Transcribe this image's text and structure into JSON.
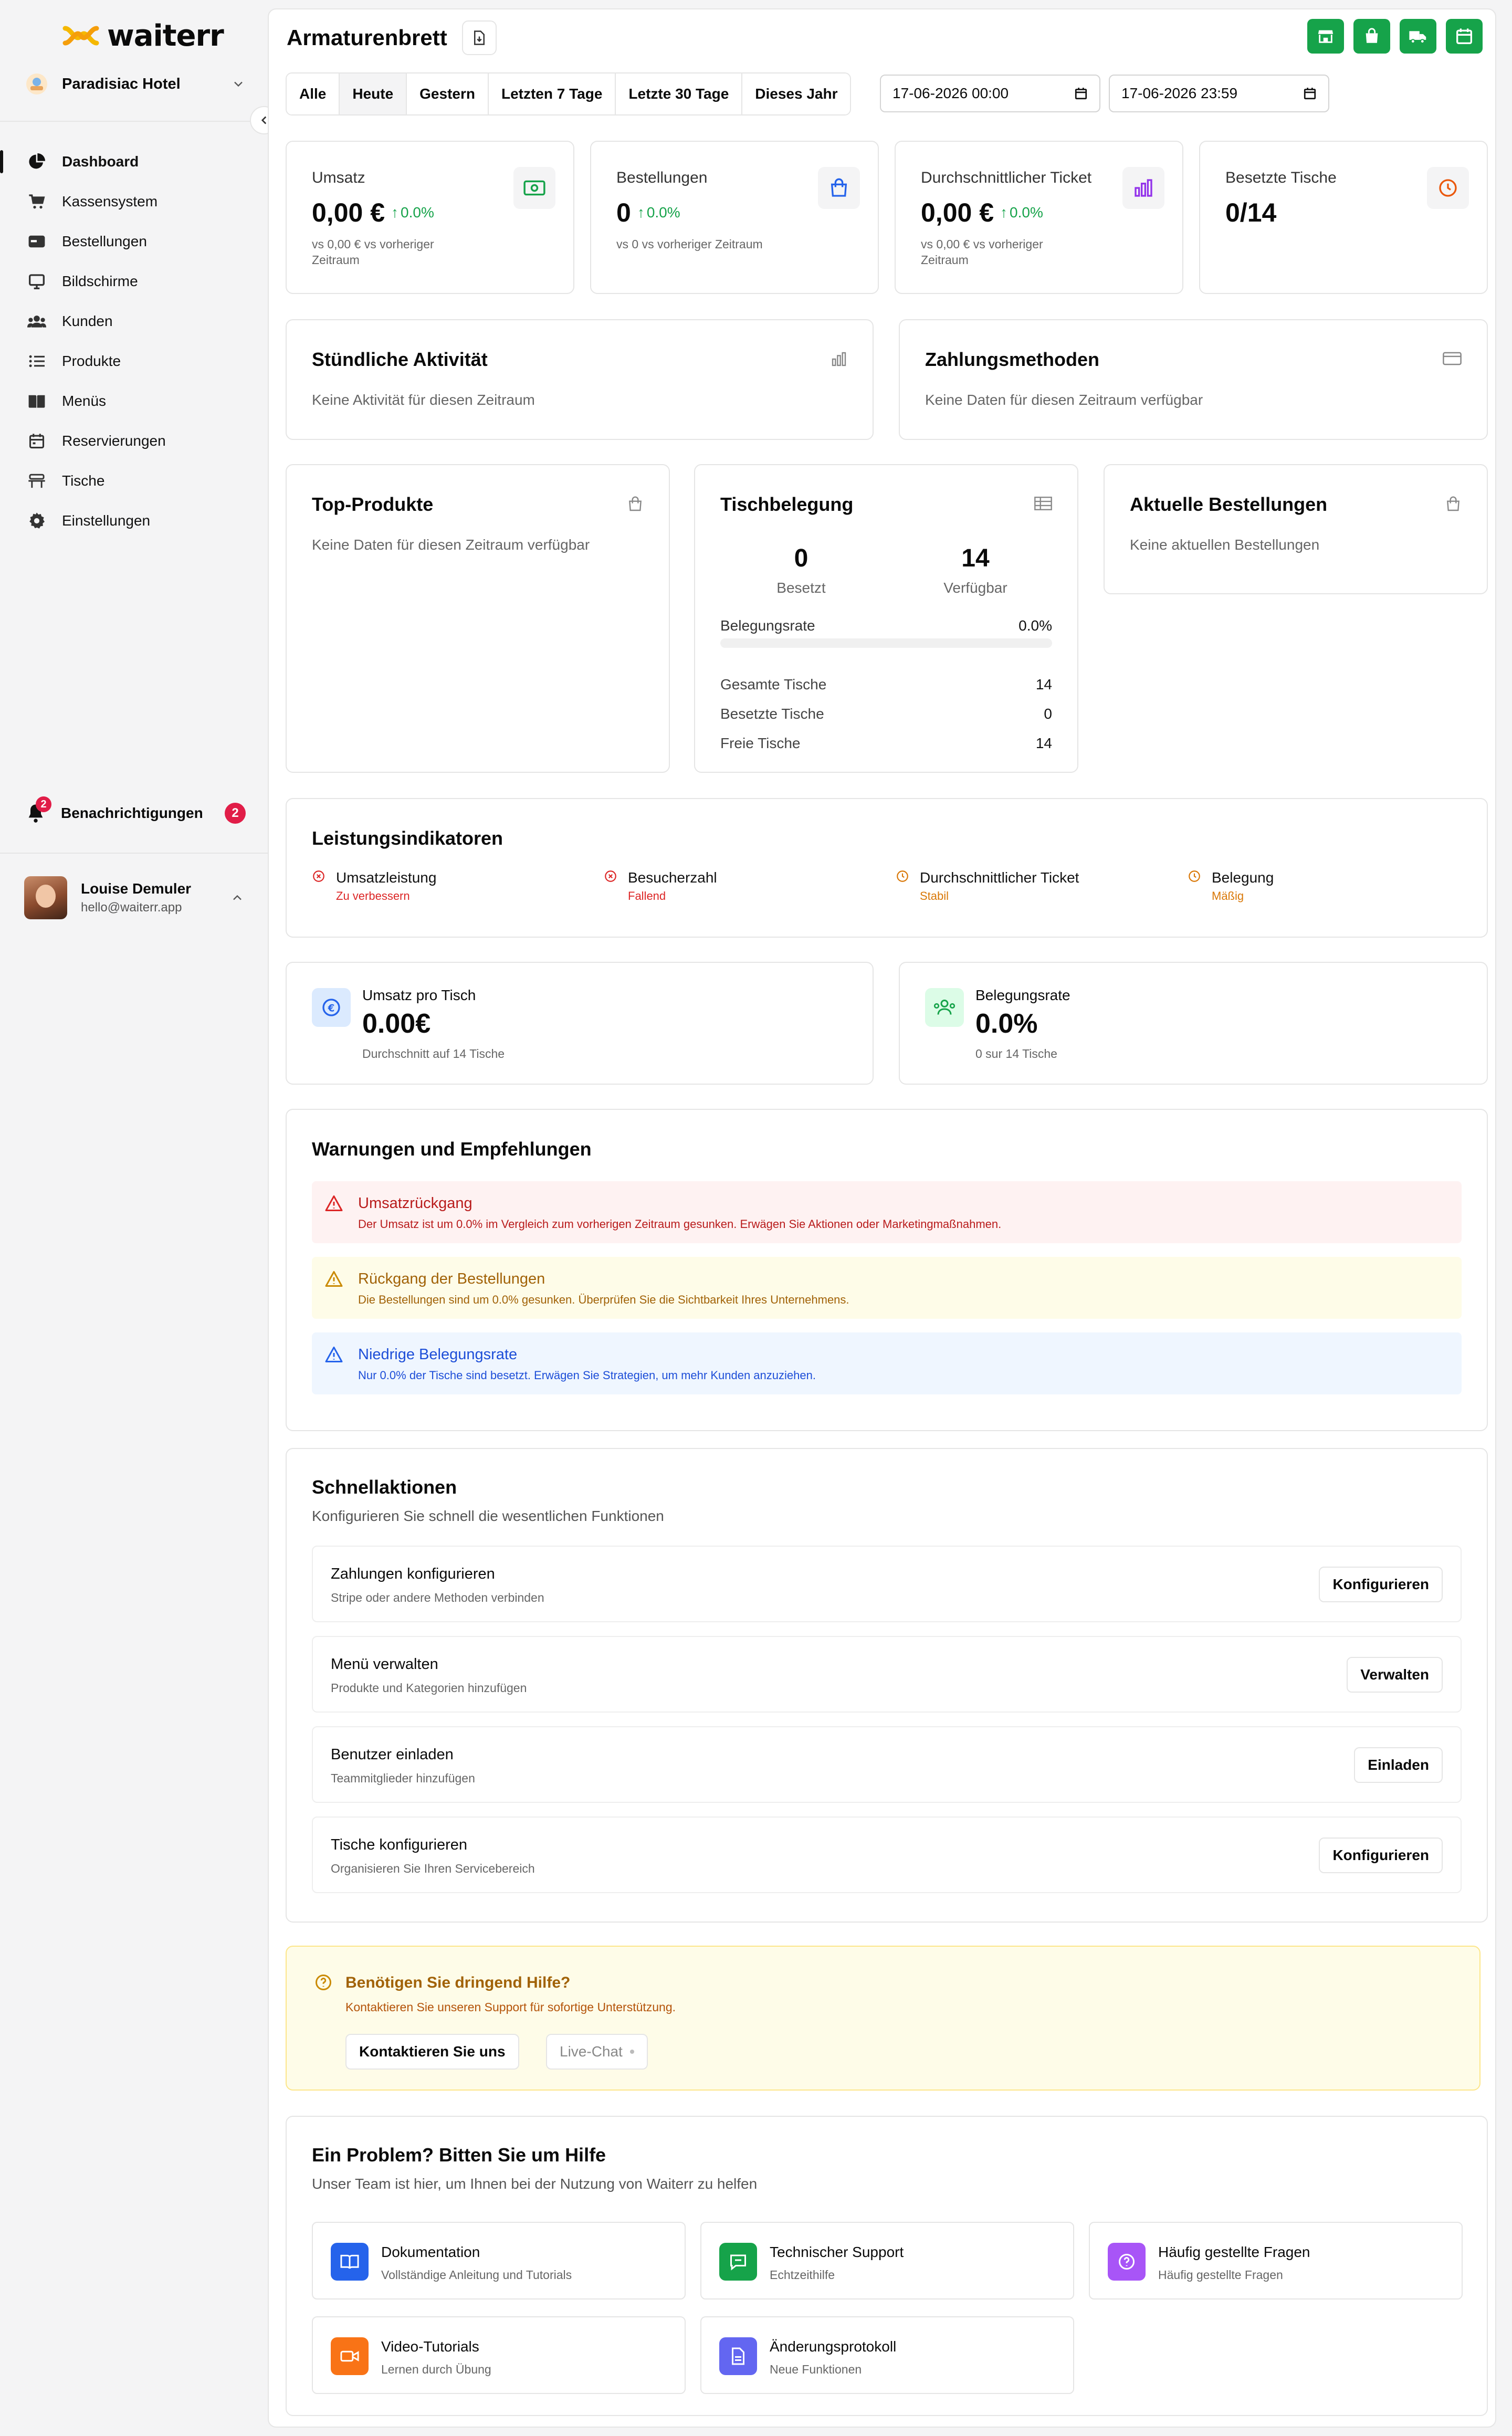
{
  "brand": {
    "name": "waiterr"
  },
  "sidebar": {
    "hotel": "Paradisiac Hotel",
    "items": [
      {
        "label": "Dashboard",
        "icon": "pie-chart-icon"
      },
      {
        "label": "Kassensystem",
        "icon": "cart-icon"
      },
      {
        "label": "Bestellungen",
        "icon": "orders-icon"
      },
      {
        "label": "Bildschirme",
        "icon": "monitor-icon"
      },
      {
        "label": "Kunden",
        "icon": "users-icon"
      },
      {
        "label": "Produkte",
        "icon": "list-icon"
      },
      {
        "label": "Menüs",
        "icon": "book-icon"
      },
      {
        "label": "Reservierungen",
        "icon": "calendar-icon"
      },
      {
        "label": "Tische",
        "icon": "table-icon"
      },
      {
        "label": "Einstellungen",
        "icon": "gear-icon"
      }
    ],
    "notifications": {
      "label": "Benachrichtigungen",
      "count": "2"
    },
    "user": {
      "name": "Louise Demuler",
      "email": "hello@waiterr.app"
    }
  },
  "header": {
    "title": "Armaturenbrett"
  },
  "filters": {
    "ranges": [
      "Alle",
      "Heute",
      "Gestern",
      "Letzten 7 Tage",
      "Letzte 30 Tage",
      "Dieses Jahr"
    ],
    "active": "Heute",
    "from": "17-06-2026 00:00",
    "to": "17-06-2026 23:59"
  },
  "stats": [
    {
      "label": "Umsatz",
      "value": "0,00 €",
      "change": "0.0%",
      "sub": "vs 0,00 € vs vorheriger Zeitraum"
    },
    {
      "label": "Bestellungen",
      "value": "0",
      "change": "0.0%",
      "sub": "vs 0 vs vorheriger Zeitraum"
    },
    {
      "label": "Durchschnittlicher Ticket",
      "value": "0,00 €",
      "change": "0.0%",
      "sub": "vs 0,00 € vs vorheriger Zeitraum"
    },
    {
      "label": "Besetzte Tische",
      "value": "0/14"
    }
  ],
  "hourly": {
    "title": "Stündliche Aktivität",
    "empty": "Keine Aktivität für diesen Zeitraum"
  },
  "payments": {
    "title": "Zahlungsmethoden",
    "empty": "Keine Daten für diesen Zeitraum verfügbar"
  },
  "top_products": {
    "title": "Top-Produkte",
    "empty": "Keine Daten für diesen Zeitraum verfügbar"
  },
  "occupancy": {
    "title": "Tischbelegung",
    "occupied": "0",
    "occupied_label": "Besetzt",
    "available": "14",
    "available_label": "Verfügbar",
    "rate_label": "Belegungsrate",
    "rate": "0.0%",
    "rate_fraction": 0,
    "total_label": "Gesamte Tische",
    "total": "14",
    "busy_label": "Besetzte Tische",
    "busy": "0",
    "free_label": "Freie Tische",
    "free": "14"
  },
  "recent_orders": {
    "title": "Aktuelle Bestellungen",
    "empty": "Keine aktuellen Bestellungen"
  },
  "indicators": {
    "title": "Leistungsindikatoren",
    "items": [
      {
        "label": "Umsatzleistung",
        "status": "Zu verbessern",
        "color": "#dc2626"
      },
      {
        "label": "Besucherzahl",
        "status": "Fallend",
        "color": "#dc2626"
      },
      {
        "label": "Durchschnittlicher Ticket",
        "status": "Stabil",
        "color": "#d97706"
      },
      {
        "label": "Belegung",
        "status": "Mäßig",
        "color": "#d97706"
      }
    ]
  },
  "kpis": [
    {
      "label": "Umsatz pro Tisch",
      "value": "0.00€",
      "sub": "Durchschnitt auf 14 Tische"
    },
    {
      "label": "Belegungsrate",
      "value": "0.0%",
      "sub": "0 sur 14 Tische"
    }
  ],
  "warnings": {
    "title": "Warnungen und Empfehlungen",
    "items": [
      {
        "title": "Umsatzrückgang",
        "desc": "Der Umsatz ist um 0.0% im Vergleich zum vorherigen Zeitraum gesunken. Erwägen Sie Aktionen oder Marketingmaßnahmen."
      },
      {
        "title": "Rückgang der Bestellungen",
        "desc": "Die Bestellungen sind um 0.0% gesunken. Überprüfen Sie die Sichtbarkeit Ihres Unternehmens."
      },
      {
        "title": "Niedrige Belegungsrate",
        "desc": "Nur 0.0% der Tische sind besetzt. Erwägen Sie Strategien, um mehr Kunden anzuziehen."
      }
    ]
  },
  "quick": {
    "title": "Schnellaktionen",
    "desc": "Konfigurieren Sie schnell die wesentlichen Funktionen",
    "items": [
      {
        "title": "Zahlungen konfigurieren",
        "desc": "Stripe oder andere Methoden verbinden",
        "button": "Konfigurieren"
      },
      {
        "title": "Menü verwalten",
        "desc": "Produkte und Kategorien hinzufügen",
        "button": "Verwalten"
      },
      {
        "title": "Benutzer einladen",
        "desc": "Teammitglieder hinzufügen",
        "button": "Einladen"
      },
      {
        "title": "Tische konfigurieren",
        "desc": "Organisieren Sie Ihren Servicebereich",
        "button": "Konfigurieren"
      }
    ]
  },
  "urgent": {
    "title": "Benötigen Sie dringend Hilfe?",
    "desc": "Kontaktieren Sie unseren Support für sofortige Unterstützung.",
    "contact": "Kontaktieren Sie uns",
    "chat": "Live-Chat"
  },
  "resources": {
    "title": "Ein Problem? Bitten Sie um Hilfe",
    "desc": "Unser Team ist hier, um Ihnen bei der Nutzung von Waiterr zu helfen",
    "items": [
      {
        "title": "Dokumentation",
        "desc": "Vollständige Anleitung und Tutorials",
        "color": "#2563eb"
      },
      {
        "title": "Technischer Support",
        "desc": "Echtzeithilfe",
        "color": "#16a34a"
      },
      {
        "title": "Häufig gestellte Fragen",
        "desc": "Häufig gestellte Fragen",
        "color": "#a855f7"
      },
      {
        "title": "Video-Tutorials",
        "desc": "Lernen durch Übung",
        "color": "#f97316"
      },
      {
        "title": "Änderungsprotokoll",
        "desc": "Neue Funktionen",
        "color": "#6366f1"
      }
    ]
  },
  "colors": {
    "accent": "#16a34a",
    "danger": "#e11d48"
  }
}
